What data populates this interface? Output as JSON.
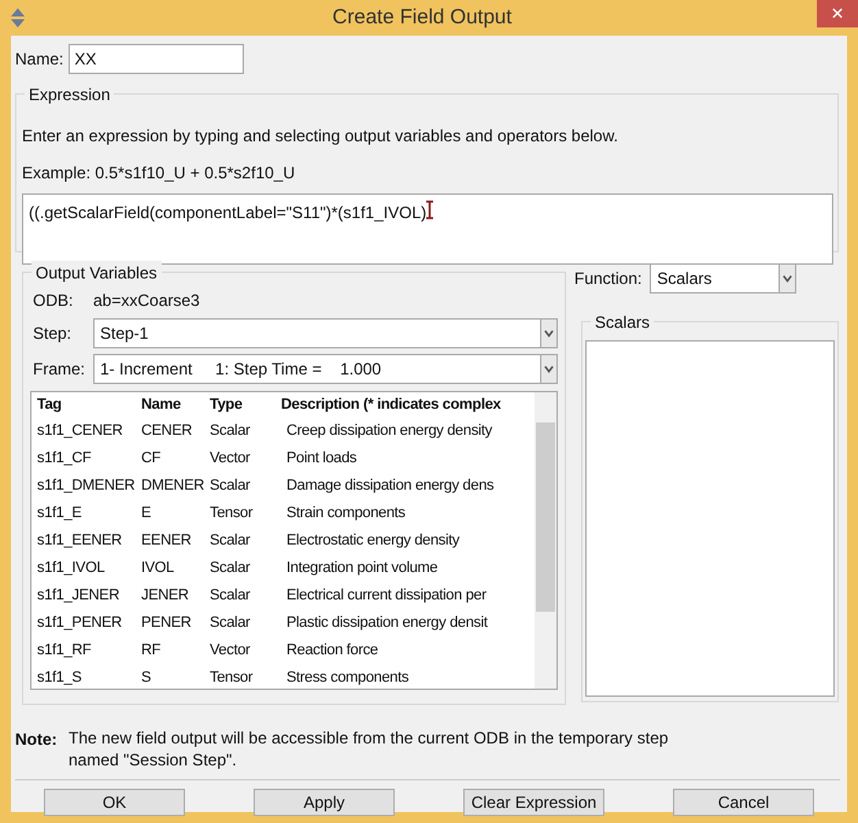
{
  "window": {
    "title": "Create Field Output",
    "close": "✕"
  },
  "name_field": {
    "label": "Name:",
    "value": "XX"
  },
  "expression": {
    "title": "Expression",
    "instruction": "Enter an expression by typing and selecting output variables and operators below.",
    "example": "Example: 0.5*s1f10_U + 0.5*s2f10_U",
    "value": "((.getScalarField(componentLabel=\"S11\")*(s1f1_IVOL)"
  },
  "output_variables": {
    "title": "Output Variables",
    "odb_label": "ODB:",
    "odb_value": "ab=xxCoarse3",
    "step_label": "Step:",
    "step_value": "Step-1",
    "frame_label": "Frame:",
    "frame_value": "1- Increment     1: Step Time =    1.000",
    "table": {
      "columns": [
        "Tag",
        "Name",
        "Type",
        "Description (* indicates complex"
      ],
      "rows": [
        [
          "s1f1_CENER",
          "CENER",
          "Scalar",
          "Creep dissipation energy density"
        ],
        [
          "s1f1_CF",
          "CF",
          "Vector",
          "Point loads"
        ],
        [
          "s1f1_DMENER",
          "DMENER",
          "Scalar",
          "Damage dissipation energy dens"
        ],
        [
          "s1f1_E",
          "E",
          "Tensor",
          "Strain components"
        ],
        [
          "s1f1_EENER",
          "EENER",
          "Scalar",
          "Electrostatic energy density"
        ],
        [
          "s1f1_IVOL",
          "IVOL",
          "Scalar",
          "Integration point volume"
        ],
        [
          "s1f1_JENER",
          "JENER",
          "Scalar",
          "Electrical current dissipation per"
        ],
        [
          "s1f1_PENER",
          "PENER",
          "Scalar",
          "Plastic dissipation energy densit"
        ],
        [
          "s1f1_RF",
          "RF",
          "Vector",
          "Reaction force"
        ],
        [
          "s1f1_S",
          "S",
          "Tensor",
          "Stress components"
        ]
      ]
    }
  },
  "function": {
    "label": "Function:",
    "value": "Scalars",
    "list_title": "Scalars"
  },
  "note": {
    "label": "Note:",
    "text": "The new field output will be accessible from the current ODB in the temporary step named \"Session Step\"."
  },
  "buttons": [
    "OK",
    "Apply",
    "Clear Expression",
    "Cancel"
  ]
}
